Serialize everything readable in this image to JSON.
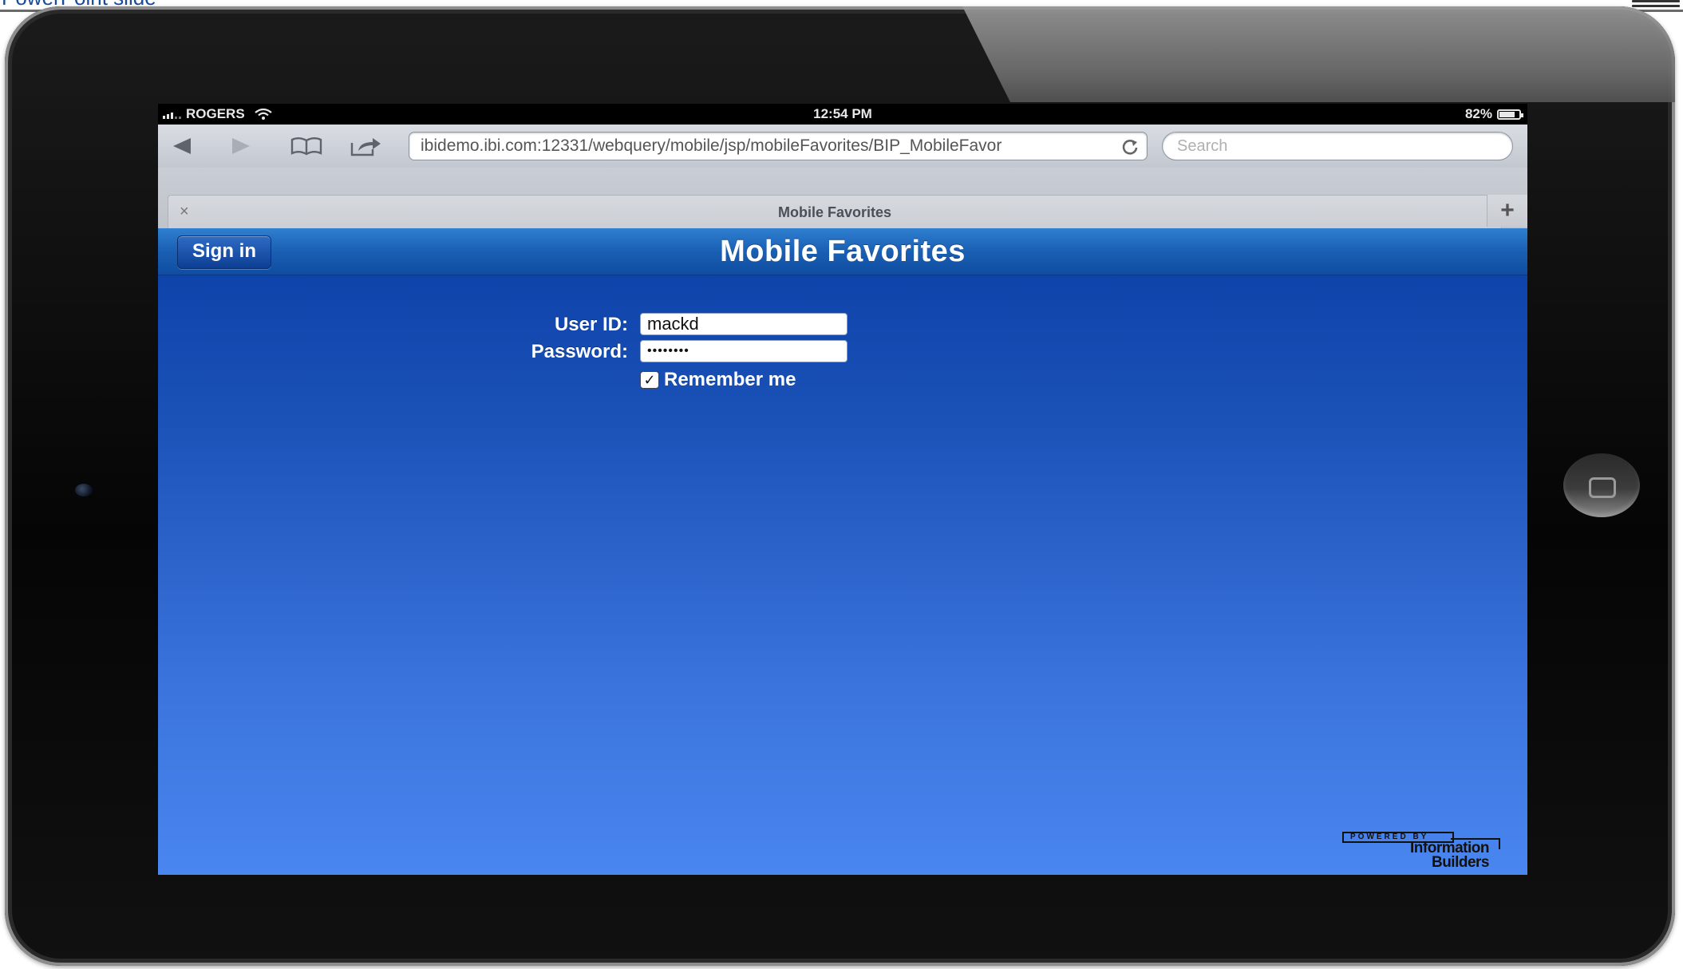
{
  "page": {
    "top_left_fragment": "PowerPoint slide",
    "background": "#ffffff"
  },
  "device": {
    "frame_color": "#0a0a0a",
    "camera_icon": "camera-icon",
    "home_button_icon": "home-button-icon"
  },
  "statusbar": {
    "carrier": "ROGERS",
    "signal_icon": "cell-signal-icon",
    "wifi_icon": "wifi-icon",
    "time": "12:54 PM",
    "battery_percent": "82%",
    "battery_level": 0.82
  },
  "toolbar": {
    "back_icon": "back-arrow-icon",
    "forward_icon": "forward-arrow-icon",
    "bookmarks_icon": "bookmarks-book-icon",
    "share_icon": "share-icon",
    "url": "ibidemo.ibi.com:12331/webquery/mobile/jsp/mobileFavorites/BIP_MobileFavor",
    "reload_icon": "reload-icon",
    "search_placeholder": "Search"
  },
  "tabs": {
    "close_label": "×",
    "title": "Mobile Favorites",
    "new_tab_label": "+"
  },
  "app": {
    "signin_label": "Sign in",
    "title": "Mobile Favorites",
    "header_color": "#1a5fb3",
    "form": {
      "user_id_label": "User ID:",
      "user_id_value": "mackd",
      "password_label": "Password:",
      "password_value": "••••••••",
      "remember_label": "Remember me",
      "remember_checked": true,
      "check_mark": "✓"
    },
    "footer": {
      "powered_by": "POWERED BY",
      "company_line1": "Information",
      "company_line2": "Builders"
    }
  }
}
